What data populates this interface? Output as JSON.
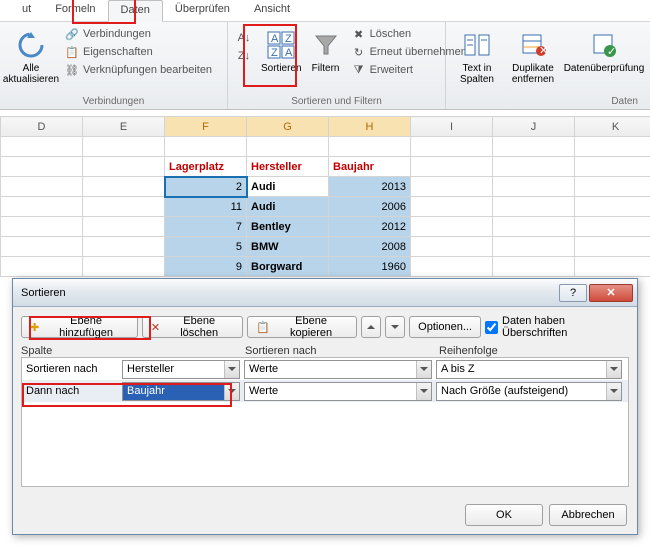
{
  "tabs": {
    "t0": "ut",
    "t1": "Formeln",
    "t2": "Daten",
    "t3": "Überprüfen",
    "t4": "Ansicht"
  },
  "ribbon": {
    "refresh": "Alle aktualisieren",
    "conn1": "Verbindungen",
    "conn2": "Eigenschaften",
    "conn3": "Verknüpfungen bearbeiten",
    "g1": "Verbindungen",
    "sort": "Sortieren",
    "filter": "Filtern",
    "f1": "Löschen",
    "f2": "Erneut übernehmen",
    "f3": "Erweitert",
    "g2": "Sortieren und Filtern",
    "ttc": "Text in Spalten",
    "dup": "Duplikate entfernen",
    "valid": "Datenüberprüfung",
    "g3": "Daten"
  },
  "cols": {
    "D": "D",
    "E": "E",
    "F": "F",
    "G": "G",
    "H": "H",
    "I": "I",
    "J": "J",
    "K": "K"
  },
  "headers": {
    "f": "Lagerplatz",
    "g": "Hersteller",
    "h": "Baujahr"
  },
  "rows": [
    {
      "f": "2",
      "g": "Audi",
      "h": "2013"
    },
    {
      "f": "11",
      "g": "Audi",
      "h": "2006"
    },
    {
      "f": "7",
      "g": "Bentley",
      "h": "2012"
    },
    {
      "f": "5",
      "g": "BMW",
      "h": "2008"
    },
    {
      "f": "9",
      "g": "Borgward",
      "h": "1960"
    }
  ],
  "dialog": {
    "title": "Sortieren",
    "add": "Ebene hinzufügen",
    "del": "Ebene löschen",
    "copy": "Ebene kopieren",
    "opts": "Optionen...",
    "chk": "Daten haben Überschriften",
    "h1": "Spalte",
    "h2": "Sortieren nach",
    "h3": "Reihenfolge",
    "r1lbl": "Sortieren nach",
    "r1c": "Hersteller",
    "r1v": "Werte",
    "r1o": "A bis Z",
    "r2lbl": "Dann nach",
    "r2c": "Baujahr",
    "r2v": "Werte",
    "r2o": "Nach Größe (aufsteigend)",
    "ok": "OK",
    "cancel": "Abbrechen"
  }
}
